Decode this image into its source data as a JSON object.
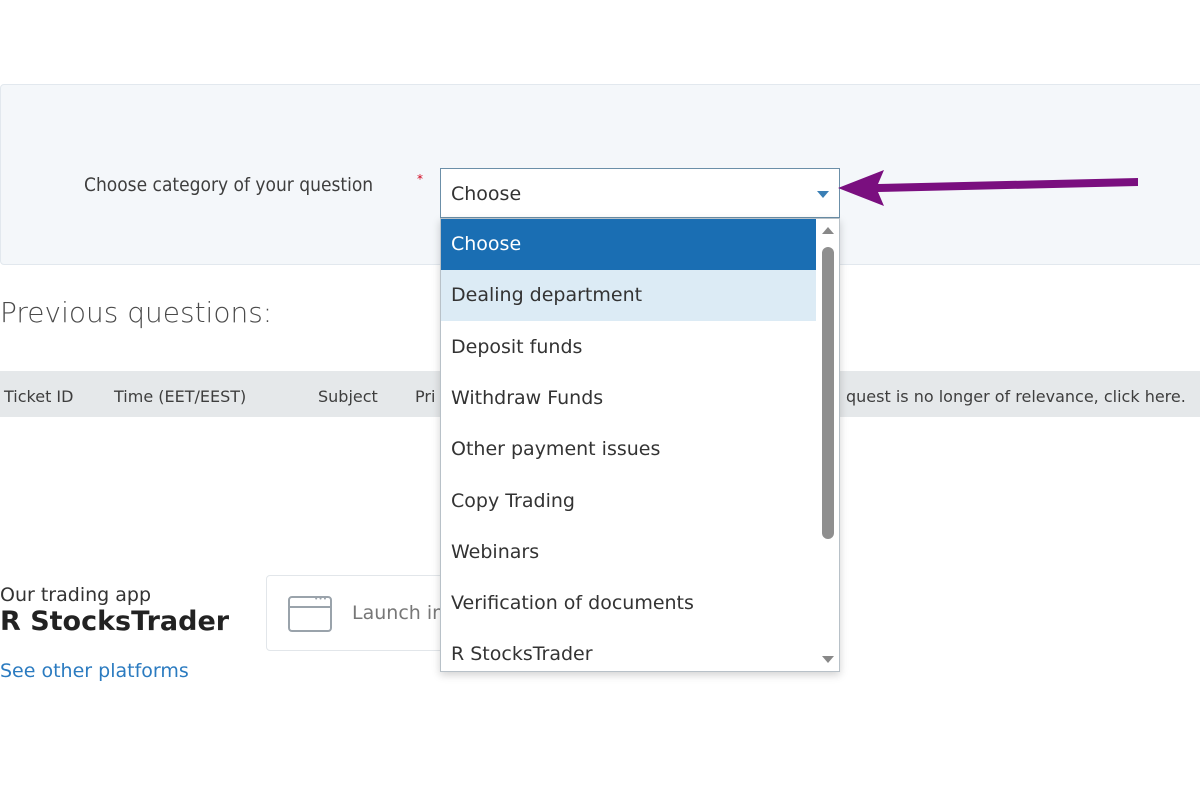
{
  "category": {
    "label": "Choose category of your question",
    "required_mark": "*",
    "select_value": "Choose",
    "options": [
      "Choose",
      "Dealing department",
      "Deposit funds",
      "Withdraw Funds",
      "Other payment issues",
      "Copy Trading",
      "Webinars",
      "Verification of documents",
      "R StocksTrader"
    ],
    "selected_index": 0,
    "hovered_index": 1
  },
  "previous": {
    "title": "Previous questions:",
    "columns": [
      "Ticket ID",
      "Time (EET/EEST)",
      "Subject",
      "Pri",
      "quest is no longer of relevance, click here."
    ]
  },
  "trading_app": {
    "caption": "Our trading app",
    "name": "R StocksTrader",
    "other_link": "See other platforms",
    "launch_label": "Launch in"
  },
  "colors": {
    "accent": "#1a6eb3",
    "hover": "#dcebf5",
    "link": "#2b7bc0",
    "annotation_arrow": "#7a0f7f"
  },
  "icons": {
    "select_caret": "caret-down-icon",
    "launch": "browser-window-icon",
    "scroll_up": "caret-up-icon",
    "scroll_down": "caret-down-icon"
  }
}
